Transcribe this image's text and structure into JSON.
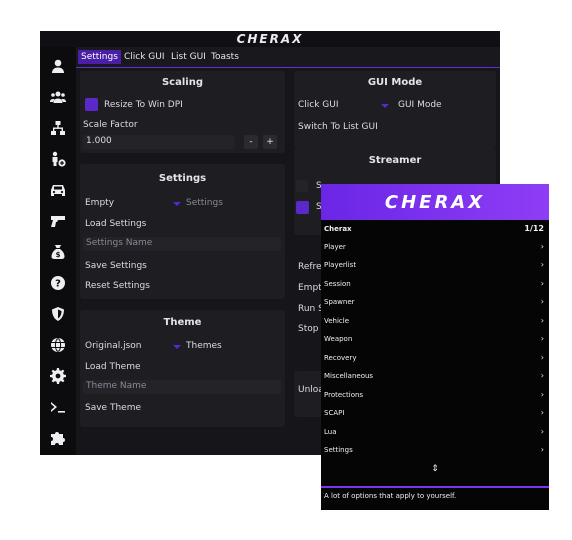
{
  "main": {
    "title": "CHERAX",
    "tabs": [
      "Settings",
      "Click GUI",
      "List GUI",
      "Toasts"
    ],
    "scaling": {
      "title": "Scaling",
      "resize_label": "Resize To Win DPI",
      "scale_factor_label": "Scale Factor",
      "scale_factor_value": "1.000",
      "minus": "-",
      "plus": "+"
    },
    "settings_panel": {
      "title": "Settings",
      "select_value": "Empty",
      "select_label": "Settings",
      "load": "Load Settings",
      "name_placeholder": "Settings Name",
      "save": "Save Settings",
      "reset": "Reset Settings"
    },
    "theme_panel": {
      "title": "Theme",
      "select_value": "Original.json",
      "select_label": "Themes",
      "load": "Load Theme",
      "name_placeholder": "Theme Name",
      "save": "Save Theme"
    },
    "gui_mode": {
      "title": "GUI Mode",
      "select_value": "Click GUI",
      "select_label": "GUI Mode",
      "switch": "Switch To List GUI"
    },
    "streamer": {
      "title": "Streamer",
      "row1": "S",
      "row2": "S"
    },
    "right_partial": [
      "Refres",
      "Empty",
      "Run S",
      "Stop S"
    ],
    "unload_partial": "Unloa",
    "sidebar_icons": [
      "user-icon",
      "users-icon",
      "network-icon",
      "player-add-icon",
      "car-icon",
      "gun-icon",
      "money-bag-icon",
      "help-icon",
      "shield-icon",
      "globe-icon",
      "gear-icon",
      "terminal-icon",
      "puzzle-icon"
    ]
  },
  "overlay": {
    "logo": "CHERAX",
    "header": "Cherax",
    "counter": "1/12",
    "items": [
      "Player",
      "Playerlist",
      "Session",
      "Spawner",
      "Vehicle",
      "Weapon",
      "Recovery",
      "Miscellaneous",
      "Protections",
      "SCAPI",
      "Lua",
      "Settings"
    ],
    "footer": "A lot of options that apply to yourself."
  },
  "colors": {
    "accent": "#5b28c9",
    "bg": "#15151a",
    "panel": "#1d1d22"
  }
}
